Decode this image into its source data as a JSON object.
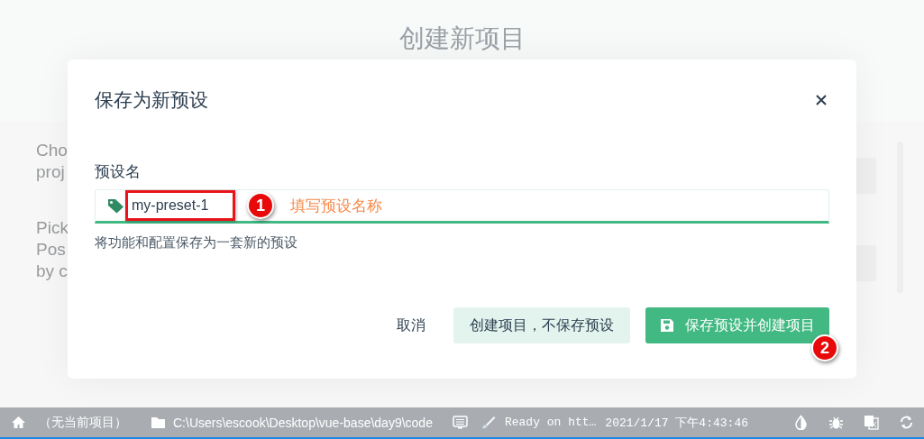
{
  "background_page": {
    "title": "创建新项目",
    "fragments": [
      "Cho",
      "proj",
      "Pick",
      "Pos",
      "by c"
    ]
  },
  "dialog": {
    "title": "保存为新预设",
    "field": {
      "label": "预设名",
      "value": "my-preset-1",
      "highlighted": true,
      "description": "将功能和配置保存为一套新的预设"
    },
    "buttons": [
      {
        "label": "取消",
        "kind": "flat"
      },
      {
        "label": "创建项目，不保存预设",
        "kind": "secondary"
      },
      {
        "label": "保存预设并创建项目",
        "kind": "primary"
      }
    ]
  },
  "annotations": {
    "step_1": "1",
    "hint": "填写预设名称",
    "step_2": "2"
  },
  "status_bar": {
    "project": "（无当前项目）",
    "path": "C:\\Users\\escook\\Desktop\\vue-base\\day9\\code",
    "log": "Ready on htt…",
    "time": "2021/1/17 下午4:43:46"
  }
}
